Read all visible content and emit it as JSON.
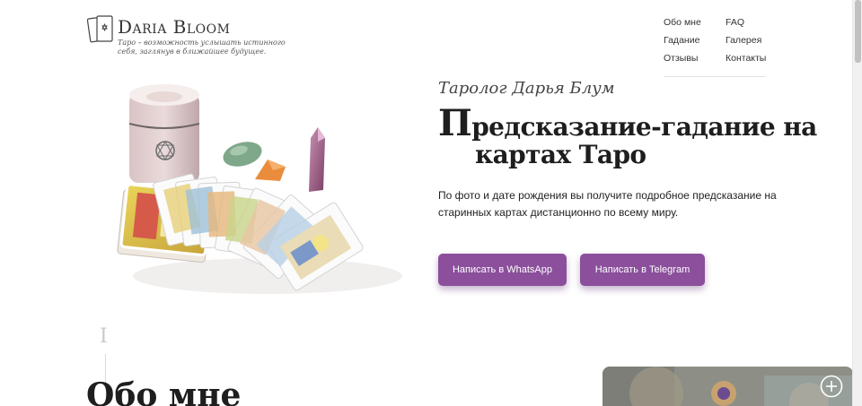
{
  "brand": {
    "name": "Daria Bloom",
    "tagline": "Таро – возможность услышать истинного себя, заглянув в ближайшее будущее."
  },
  "nav": {
    "items": [
      "Обо мне",
      "FAQ",
      "Гадание",
      "Галерея",
      "Отзывы",
      "Контакты"
    ]
  },
  "hero": {
    "subtitle": "Таролог Дарья Блум",
    "title_cap": "П",
    "title_line1_rest": "редсказание-гадание на",
    "title_line2": "картах Таро",
    "description": "По фото и дате рождения вы получите подробное предсказание на старинных картах дистанционно по всему миру.",
    "buttons": {
      "whatsapp": "Написать в WhatsApp",
      "telegram": "Написать в Telegram"
    }
  },
  "about": {
    "number": "I",
    "title": "Обо мне"
  },
  "icons": {
    "logo": "tarot-cards-star-icon",
    "expand": "plus-circle-icon"
  },
  "colors": {
    "accent": "#8b4f9c",
    "text": "#1e1e1e",
    "background": "#ffffff"
  }
}
